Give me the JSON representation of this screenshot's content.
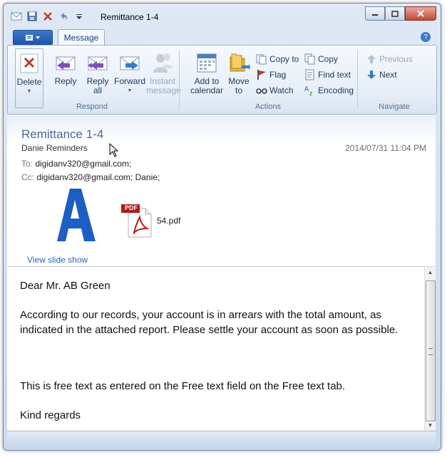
{
  "window": {
    "title": "Remittance 1-4"
  },
  "quick_access": {
    "items": [
      "mail-icon",
      "save-icon",
      "delete-icon",
      "undo-icon",
      "customize-icon"
    ]
  },
  "tabs": {
    "message": "Message"
  },
  "ribbon": {
    "respond": {
      "label": "Respond",
      "delete": "Delete",
      "reply": "Reply",
      "reply_all_1": "Reply",
      "reply_all_2": "all",
      "forward": "Forward",
      "instant_1": "Instant",
      "instant_2": "message"
    },
    "actions": {
      "label": "Actions",
      "add_1": "Add to",
      "add_2": "calendar",
      "move_1": "Move",
      "move_2": "to",
      "copy_to": "Copy to",
      "flag": "Flag",
      "watch": "Watch",
      "copy": "Copy",
      "find_text": "Find text",
      "encoding": "Encoding"
    },
    "navigate": {
      "label": "Navigate",
      "previous": "Previous",
      "next": "Next"
    }
  },
  "message": {
    "subject": "Remittance 1-4",
    "from": "Danie Reminders",
    "date": "2014/07/31 11:04 PM",
    "to_label": "To:",
    "to": "digidanv320@gmail.com;",
    "cc_label": "Cc:",
    "cc": "digidanv320@gmail.com; Danie;",
    "attachment_name": "54.pdf",
    "pdf_badge": "PDF",
    "slide_show": "View slide show",
    "body": {
      "greeting": "Dear Mr. AB Green",
      "para1": "According to our records, your account is in arrears with the total amount, as indicated in the attached report. Please settle your account as soon as possible.",
      "para2": "This is free text as entered on the Free text field on the Free text tab.",
      "closing": "Kind regards"
    }
  },
  "colors": {
    "accent": "#1d55a8",
    "subject": "#4b6a95",
    "link": "#2a68b5"
  }
}
